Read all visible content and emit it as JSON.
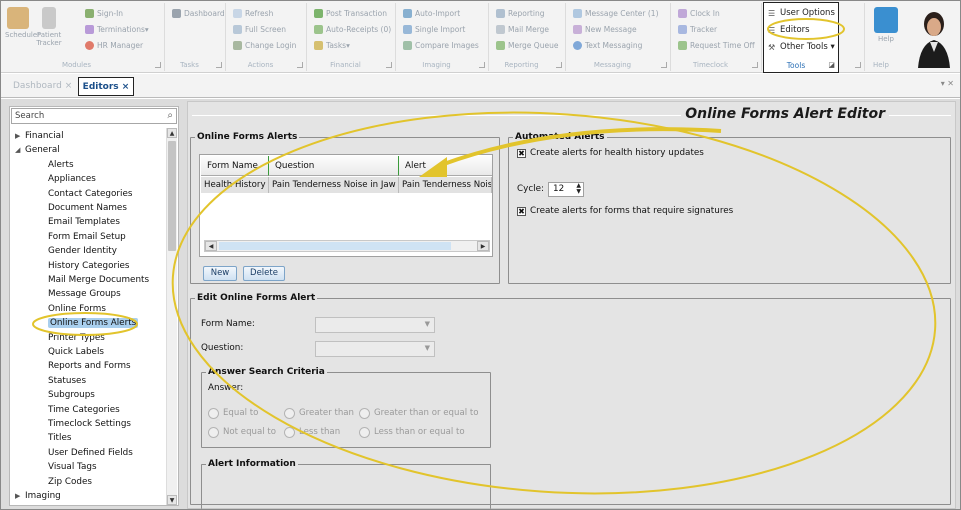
{
  "ribbon": {
    "groups": [
      {
        "caption": "Modules",
        "items": [
          "Scheduler",
          "Patient Tracker",
          "Sign-In",
          "Terminations",
          "HR Manager"
        ]
      },
      {
        "caption": "Tasks",
        "items": [
          "Dashboard"
        ]
      },
      {
        "caption": "Actions",
        "items": [
          "Refresh",
          "Full Screen",
          "Change Login"
        ]
      },
      {
        "caption": "Financial",
        "items": [
          "Post Transaction",
          "Auto-Receipts (0)",
          "Tasks"
        ]
      },
      {
        "caption": "Imaging",
        "items": [
          "Auto-Import",
          "Single Import",
          "Compare Images"
        ]
      },
      {
        "caption": "Reporting",
        "items": [
          "Reporting",
          "Mail Merge",
          "Merge Queue"
        ]
      },
      {
        "caption": "Messaging",
        "items": [
          "Message Center (1)",
          "New Message",
          "Text Messaging"
        ]
      },
      {
        "caption": "Timeclock",
        "items": [
          "Clock In",
          "Tracker",
          "Request Time Off"
        ]
      },
      {
        "caption": "Help",
        "items": [
          "Help"
        ]
      }
    ],
    "tools": {
      "caption": "Tools",
      "user_options": "User Options",
      "editors": "Editors",
      "other_tools": "Other Tools"
    }
  },
  "tabs": [
    {
      "label": "Dashboard",
      "close": "×"
    },
    {
      "label": "Editors",
      "close": "×"
    }
  ],
  "sidebar": {
    "search_placeholder": "Search",
    "tree": [
      {
        "label": "Financial",
        "level": 0,
        "expander": "▶"
      },
      {
        "label": "General",
        "level": 0,
        "expander": "◢"
      },
      {
        "label": "Alerts",
        "level": 1
      },
      {
        "label": "Appliances",
        "level": 1
      },
      {
        "label": "Contact Categories",
        "level": 1
      },
      {
        "label": "Document Names",
        "level": 1
      },
      {
        "label": "Email Templates",
        "level": 1
      },
      {
        "label": "Form Email Setup",
        "level": 1
      },
      {
        "label": "Gender Identity",
        "level": 1
      },
      {
        "label": "History Categories",
        "level": 1
      },
      {
        "label": "Mail Merge Documents",
        "level": 1
      },
      {
        "label": "Message Groups",
        "level": 1
      },
      {
        "label": "Online Forms",
        "level": 1
      },
      {
        "label": "Online Forms Alerts",
        "level": 1,
        "selected": true
      },
      {
        "label": "Printer Types",
        "level": 1
      },
      {
        "label": "Quick Labels",
        "level": 1
      },
      {
        "label": "Reports and Forms",
        "level": 1
      },
      {
        "label": "Statuses",
        "level": 1
      },
      {
        "label": "Subgroups",
        "level": 1
      },
      {
        "label": "Time Categories",
        "level": 1
      },
      {
        "label": "Timeclock Settings",
        "level": 1
      },
      {
        "label": "Titles",
        "level": 1
      },
      {
        "label": "User Defined Fields",
        "level": 1
      },
      {
        "label": "Visual Tags",
        "level": 1
      },
      {
        "label": "Zip Codes",
        "level": 1
      },
      {
        "label": "Imaging",
        "level": 0,
        "expander": "▶"
      }
    ]
  },
  "editor": {
    "title": "Online Forms Alert Editor",
    "alerts_section": {
      "legend": "Online Forms Alerts",
      "columns": [
        "Form Name",
        "Question",
        "Alert"
      ],
      "rows": [
        [
          "Health History",
          "Pain Tenderness Noise in Jaw",
          "Pain Tenderness Noise"
        ]
      ],
      "new_label": "New",
      "delete_label": "Delete"
    },
    "automated": {
      "legend": "Automated Alerts",
      "health_history_label": "Create alerts for health history updates",
      "health_history_checked": true,
      "cycle_label": "Cycle:",
      "cycle_value": "12",
      "signatures_label": "Create alerts for forms that require signatures",
      "signatures_checked": true,
      "check_glyph": "✖"
    },
    "edit_section": {
      "legend": "Edit Online Forms Alert",
      "form_name_label": "Form Name:",
      "question_label": "Question:",
      "criteria_legend": "Answer Search Criteria",
      "answer_label": "Answer:",
      "options": [
        "Equal to",
        "Greater than",
        "Greater than or equal to",
        "Not equal to",
        "Less than",
        "Less than or equal to"
      ],
      "alert_info_legend": "Alert Information"
    }
  },
  "colors": {
    "callout": "#e2c42c",
    "selected": "#a9cfee",
    "accent": "#1b4f8a"
  }
}
